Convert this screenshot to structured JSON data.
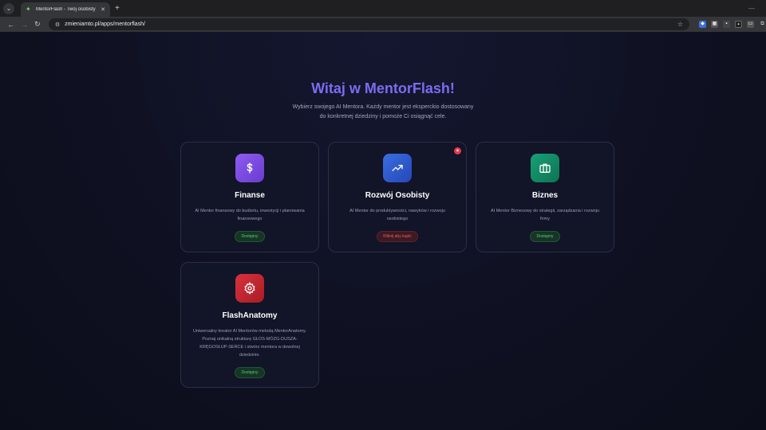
{
  "browser": {
    "tab_title": "MentorFlash - Twój osobisty m",
    "url": "zmieniamto.pl/apps/mentorflash/"
  },
  "hero": {
    "title": "Witaj w MentorFlash!",
    "subtitle_line1": "Wybierz swojego AI Mentora. Każdy mentor jest eksperckio dostosowany",
    "subtitle_line2": "do konkretnej dziedziny i pomoże Ci osiągnąć cele."
  },
  "cards": [
    {
      "title": "Finanse",
      "description": "AI Mentor finansowy do budżetu, inwestycji i planowania finansowego",
      "badge": "Dostępny",
      "icon": "dollar-icon",
      "color": "#7c4dde"
    },
    {
      "title": "Rozwój Osobisty",
      "description": "AI Mentor do produktywności, nawyków i rozwoju osobistego",
      "badge": "Kliknij aby kupić",
      "icon": "trending-up-icon",
      "color": "#2f5fd6"
    },
    {
      "title": "Biznes",
      "description": "AI Mentor Biznesowy do strategii, zarządzania i rozwoju firmy",
      "badge": "Dostępny",
      "icon": "briefcase-icon",
      "color": "#128b63"
    },
    {
      "title": "FlashAnatomy",
      "description": "Uniwersalny kreator AI Mentorów metodą MentorAnatomy. Poznaj unikalną strukturę GŁOS-MÓZG-DUSZA-KRĘGOSŁUP-SERCE i stwórz mentora w dowolnej dziedzinie.",
      "badge": "Dostępny",
      "icon": "gear-icon",
      "color": "#c9262f"
    }
  ],
  "colors": {
    "accent": "#7b6cf0",
    "available": "#4ad27b",
    "locked": "#f05a6a"
  }
}
